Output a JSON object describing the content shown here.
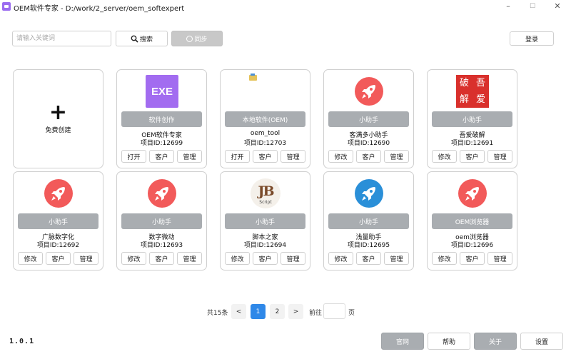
{
  "window": {
    "title": "OEM软件专家 - D:/work/2_server/oem_softexpert",
    "minimize_glyph": "–",
    "maximize_glyph": "☐",
    "close_glyph": "✕"
  },
  "toolbar": {
    "search_placeholder": "请输入关键词",
    "search_label": "搜索",
    "sync_label": "同步",
    "login_label": "登录"
  },
  "create_card": {
    "plus": "+",
    "label": "免费创建"
  },
  "cards": [
    {
      "icon": "exe-icon",
      "icon_text": "EXE",
      "category": "软件创作",
      "name": "OEM软件专家",
      "project_id": "项目ID:12699",
      "actions": [
        "打开",
        "客户",
        "管理"
      ]
    },
    {
      "icon": "folder-icon",
      "category": "本地软件(OEM)",
      "name": "oem_tool",
      "project_id": "项目ID:12703",
      "actions": [
        "打开",
        "客户",
        "管理"
      ]
    },
    {
      "icon": "rocket-icon",
      "icon_color": "#f25a5a",
      "category": "小助手",
      "name": "客满多小助手",
      "project_id": "项目ID:12690",
      "actions": [
        "修改",
        "客户",
        "管理"
      ]
    },
    {
      "icon": "seal-icon",
      "icon_chars": [
        "破",
        "吾",
        "解",
        "爱"
      ],
      "category": "小助手",
      "name": "吾爱破解",
      "project_id": "项目ID:12691",
      "actions": [
        "修改",
        "客户",
        "管理"
      ]
    },
    {
      "icon": "rocket-icon",
      "icon_color": "#f25a5a",
      "category": "小助手",
      "name": "广脉数字化",
      "project_id": "项目ID:12692",
      "actions": [
        "修改",
        "客户",
        "管理"
      ]
    },
    {
      "icon": "rocket-icon",
      "icon_color": "#f25a5a",
      "category": "小助手",
      "name": "数字微动",
      "project_id": "项目ID:12693",
      "actions": [
        "修改",
        "客户",
        "管理"
      ]
    },
    {
      "icon": "jb-icon",
      "icon_text": "JB",
      "icon_subtext": "Script",
      "category": "小助手",
      "name": "脚本之家",
      "project_id": "项目ID:12694",
      "actions": [
        "修改",
        "客户",
        "管理"
      ]
    },
    {
      "icon": "rocket-icon",
      "icon_color": "#2a8fd8",
      "category": "小助手",
      "name": "浅量助手",
      "project_id": "项目ID:12695",
      "actions": [
        "修改",
        "客户",
        "管理"
      ]
    },
    {
      "icon": "rocket-icon",
      "icon_color": "#f25a5a",
      "category": "OEM浏览器",
      "name": "oem浏览器",
      "project_id": "项目ID:12696",
      "actions": [
        "修改",
        "客户",
        "管理"
      ]
    }
  ],
  "pagination": {
    "total": "共15条",
    "prev": "<",
    "pages": [
      "1",
      "2"
    ],
    "current_page": "1",
    "next": ">",
    "goto_label": "前往",
    "page_unit": "页"
  },
  "footer": {
    "version": "1.0.1",
    "website_label": "官网",
    "help_label": "帮助",
    "about_label": "关于",
    "settings_label": "设置"
  }
}
